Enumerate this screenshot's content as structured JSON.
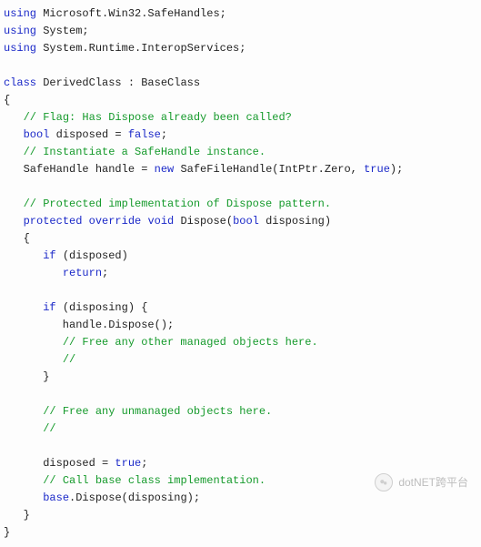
{
  "code": {
    "lines": [
      {
        "indent": 0,
        "segs": [
          {
            "c": "kw",
            "t": "using"
          },
          {
            "c": "",
            "t": " Microsoft.Win32.SafeHandles;"
          }
        ]
      },
      {
        "indent": 0,
        "segs": [
          {
            "c": "kw",
            "t": "using"
          },
          {
            "c": "",
            "t": " System;"
          }
        ]
      },
      {
        "indent": 0,
        "segs": [
          {
            "c": "kw",
            "t": "using"
          },
          {
            "c": "",
            "t": " System.Runtime.InteropServices;"
          }
        ]
      },
      {
        "indent": 0,
        "segs": [
          {
            "c": "",
            "t": ""
          }
        ]
      },
      {
        "indent": 0,
        "segs": [
          {
            "c": "kw",
            "t": "class"
          },
          {
            "c": "",
            "t": " DerivedClass : BaseClass"
          }
        ]
      },
      {
        "indent": 0,
        "segs": [
          {
            "c": "",
            "t": "{"
          }
        ]
      },
      {
        "indent": 1,
        "segs": [
          {
            "c": "cm",
            "t": "// Flag: Has Dispose already been called?"
          }
        ]
      },
      {
        "indent": 1,
        "segs": [
          {
            "c": "kw",
            "t": "bool"
          },
          {
            "c": "",
            "t": " disposed = "
          },
          {
            "c": "kw",
            "t": "false"
          },
          {
            "c": "",
            "t": ";"
          }
        ]
      },
      {
        "indent": 1,
        "segs": [
          {
            "c": "cm",
            "t": "// Instantiate a SafeHandle instance."
          }
        ]
      },
      {
        "indent": 1,
        "segs": [
          {
            "c": "",
            "t": "SafeHandle handle = "
          },
          {
            "c": "kw",
            "t": "new"
          },
          {
            "c": "",
            "t": " SafeFileHandle(IntPtr.Zero, "
          },
          {
            "c": "kw",
            "t": "true"
          },
          {
            "c": "",
            "t": ");"
          }
        ]
      },
      {
        "indent": 0,
        "segs": [
          {
            "c": "",
            "t": ""
          }
        ]
      },
      {
        "indent": 1,
        "segs": [
          {
            "c": "cm",
            "t": "// Protected implementation of Dispose pattern."
          }
        ]
      },
      {
        "indent": 1,
        "segs": [
          {
            "c": "kw",
            "t": "protected"
          },
          {
            "c": "",
            "t": " "
          },
          {
            "c": "kw",
            "t": "override"
          },
          {
            "c": "",
            "t": " "
          },
          {
            "c": "kw",
            "t": "void"
          },
          {
            "c": "",
            "t": " Dispose("
          },
          {
            "c": "kw",
            "t": "bool"
          },
          {
            "c": "",
            "t": " disposing)"
          }
        ]
      },
      {
        "indent": 1,
        "segs": [
          {
            "c": "",
            "t": "{"
          }
        ]
      },
      {
        "indent": 2,
        "segs": [
          {
            "c": "kw",
            "t": "if"
          },
          {
            "c": "",
            "t": " (disposed)"
          }
        ]
      },
      {
        "indent": 3,
        "segs": [
          {
            "c": "kw",
            "t": "return"
          },
          {
            "c": "",
            "t": ";"
          }
        ]
      },
      {
        "indent": 0,
        "segs": [
          {
            "c": "",
            "t": ""
          }
        ]
      },
      {
        "indent": 2,
        "segs": [
          {
            "c": "kw",
            "t": "if"
          },
          {
            "c": "",
            "t": " (disposing) {"
          }
        ]
      },
      {
        "indent": 3,
        "segs": [
          {
            "c": "",
            "t": "handle.Dispose();"
          }
        ]
      },
      {
        "indent": 3,
        "segs": [
          {
            "c": "cm",
            "t": "// Free any other managed objects here."
          }
        ]
      },
      {
        "indent": 3,
        "segs": [
          {
            "c": "cm",
            "t": "//"
          }
        ]
      },
      {
        "indent": 2,
        "segs": [
          {
            "c": "",
            "t": "}"
          }
        ]
      },
      {
        "indent": 0,
        "segs": [
          {
            "c": "",
            "t": ""
          }
        ]
      },
      {
        "indent": 2,
        "segs": [
          {
            "c": "cm",
            "t": "// Free any unmanaged objects here."
          }
        ]
      },
      {
        "indent": 2,
        "segs": [
          {
            "c": "cm",
            "t": "//"
          }
        ]
      },
      {
        "indent": 0,
        "segs": [
          {
            "c": "",
            "t": ""
          }
        ]
      },
      {
        "indent": 2,
        "segs": [
          {
            "c": "",
            "t": "disposed = "
          },
          {
            "c": "kw",
            "t": "true"
          },
          {
            "c": "",
            "t": ";"
          }
        ]
      },
      {
        "indent": 2,
        "segs": [
          {
            "c": "cm",
            "t": "// Call base class implementation."
          }
        ]
      },
      {
        "indent": 2,
        "segs": [
          {
            "c": "kw",
            "t": "base"
          },
          {
            "c": "",
            "t": ".Dispose(disposing);"
          }
        ]
      },
      {
        "indent": 1,
        "segs": [
          {
            "c": "",
            "t": "}"
          }
        ]
      },
      {
        "indent": 0,
        "segs": [
          {
            "c": "",
            "t": "}"
          }
        ]
      }
    ]
  },
  "watermark": {
    "label": "dotNET跨平台"
  }
}
